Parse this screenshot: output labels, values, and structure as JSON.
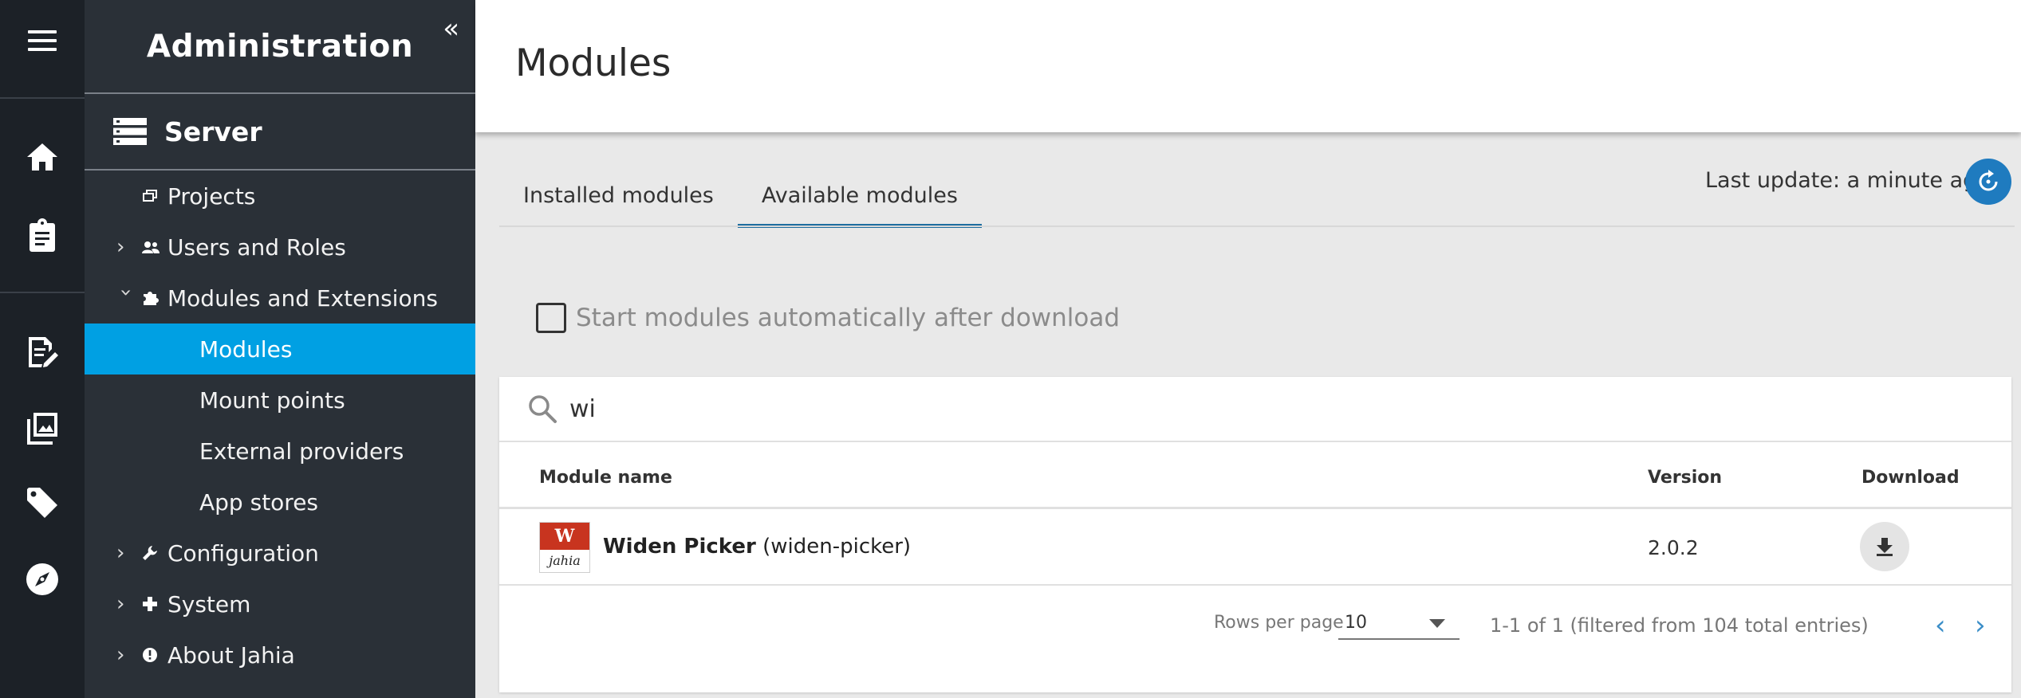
{
  "rail": {
    "icons": [
      "menu-icon",
      "home-icon",
      "clipboard-icon",
      "edit-document-icon",
      "images-icon",
      "tag-icon",
      "compass-icon"
    ]
  },
  "sidebar": {
    "title": "Administration",
    "collapse_glyph": "«",
    "section": "Server",
    "items": [
      {
        "label": "Projects",
        "icon": "projects-icon",
        "expandable": false
      },
      {
        "label": "Users and Roles",
        "icon": "users-icon",
        "expandable": true,
        "expanded": false
      },
      {
        "label": "Modules and Extensions",
        "icon": "puzzle-icon",
        "expandable": true,
        "expanded": true
      },
      {
        "label": "Modules",
        "sub": true,
        "active": true
      },
      {
        "label": "Mount points",
        "sub": true
      },
      {
        "label": "External providers",
        "sub": true
      },
      {
        "label": "App stores",
        "sub": true
      },
      {
        "label": "Configuration",
        "icon": "wrench-icon",
        "expandable": true,
        "expanded": false
      },
      {
        "label": "System",
        "icon": "plus-icon",
        "expandable": true,
        "expanded": false
      },
      {
        "label": "About Jahia",
        "icon": "info-icon",
        "expandable": true,
        "expanded": false
      }
    ]
  },
  "header": {
    "title": "Modules"
  },
  "tabs": [
    {
      "label": "Installed modules",
      "active": false
    },
    {
      "label": "Available modules",
      "active": true
    }
  ],
  "last_update": "Last update: a minute ago",
  "auto_start": {
    "label": "Start modules automatically after download",
    "checked": false
  },
  "search": {
    "value": "wi"
  },
  "table": {
    "columns": {
      "name": "Module name",
      "version": "Version",
      "download": "Download"
    },
    "rows": [
      {
        "logo_top": "W",
        "logo_bottom": "jahia",
        "title": "Widen Picker",
        "id": "(widen-picker)",
        "version": "2.0.2"
      }
    ]
  },
  "pagination": {
    "rows_per_page_label": "Rows per page",
    "rows_per_page": "10",
    "range": "1-1 of 1 (filtered from 104 total entries)",
    "prev": "‹",
    "next": "›"
  },
  "colors": {
    "rail_bg": "#1c2127",
    "sidebar_bg": "#2a3037",
    "active_item": "#00a0e3",
    "tab_underline": "#1f6ea0",
    "refresh_button": "#1f7bbf",
    "logo_red": "#c8341f"
  }
}
